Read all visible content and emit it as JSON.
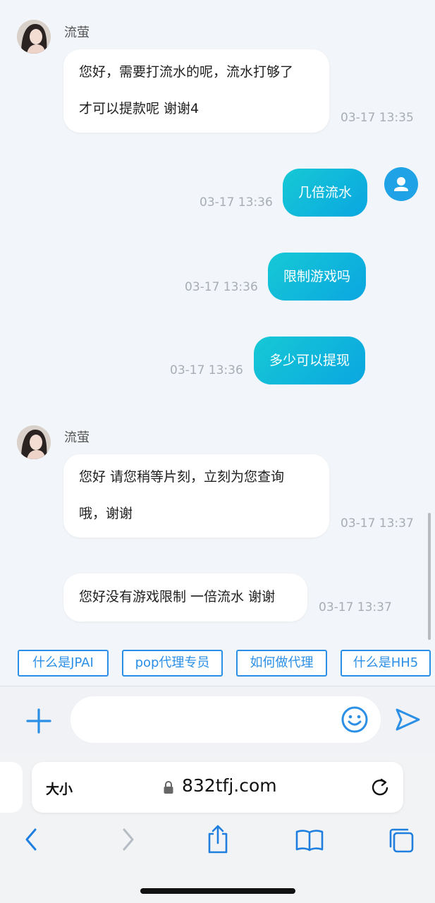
{
  "agent": {
    "name": "流萤"
  },
  "messages": [
    {
      "from": "agent",
      "lines": [
        "您好，需要打流水的呢，流水打够了",
        "才可以提款呢 谢谢4"
      ],
      "time": "03-17 13:35"
    },
    {
      "from": "user",
      "text": "几倍流水",
      "time": "03-17 13:36"
    },
    {
      "from": "user",
      "text": "限制游戏吗",
      "time": "03-17 13:36"
    },
    {
      "from": "user",
      "text": "多少可以提现",
      "time": "03-17 13:36"
    },
    {
      "from": "agent",
      "lines": [
        "您好 请您稍等片刻，立刻为您查询",
        "哦，谢谢"
      ],
      "time": "03-17 13:37"
    },
    {
      "from": "agent",
      "lines": [
        "您好没有游戏限制 一倍流水 谢谢"
      ],
      "time": "03-17 13:37"
    }
  ],
  "quick_replies": [
    "什么是JPAI",
    "pop代理专员",
    "如何做代理",
    "什么是HH5"
  ],
  "input": {
    "value": "",
    "placeholder": ""
  },
  "browser": {
    "text_size_label": "大小",
    "url": "832tfj.com"
  },
  "icons": {
    "add": "plus-icon",
    "emoji": "emoji-icon",
    "send": "send-icon",
    "lock": "lock-icon",
    "reload": "reload-icon",
    "back": "chevron-left-icon",
    "forward": "chevron-right-icon",
    "share": "share-icon",
    "bookmarks": "book-icon",
    "tabs": "tabs-icon"
  },
  "colors": {
    "accent": "#2b8fe6",
    "bubble_out_start": "#16c9d5",
    "bubble_out_end": "#0aa6e0",
    "background": "#f2f5f9"
  }
}
